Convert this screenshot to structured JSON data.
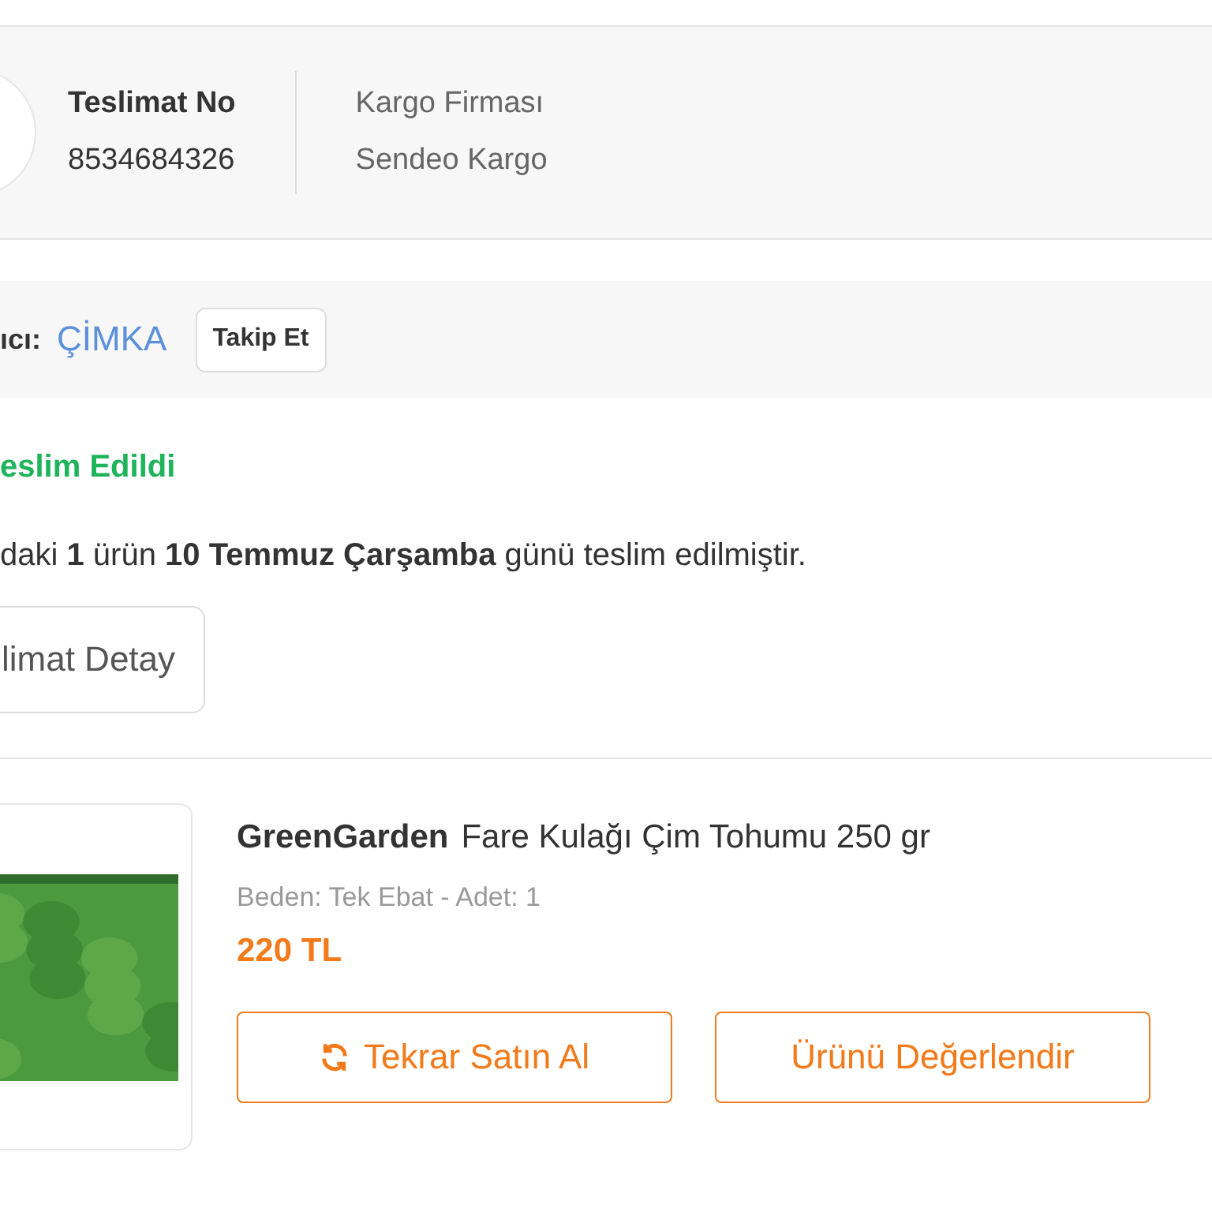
{
  "delivery": {
    "number_label": "Teslimat No",
    "number": "8534684326",
    "carrier_label": "Kargo Firması",
    "carrier": "Sendeo Kargo"
  },
  "seller": {
    "label": "ıcı:",
    "name": "ÇİMKA",
    "follow_button": "Takip Et"
  },
  "status": {
    "text": "eslim Edildi",
    "message": "daki **1** ürün **10 Temmuz Çarşamba** günü teslim edilmiştir.",
    "detail_button": "limat Detay"
  },
  "product": {
    "brand": "GreenGarden",
    "name": "Fare Kulağı Çim Tohumu 250 gr",
    "variant": "Beden: Tek Ebat - Adet: 1",
    "price": "220 TL",
    "buttons": [
      {
        "kind": "rebuy",
        "label": "Tekrar Satın Al"
      },
      {
        "kind": "review",
        "label": "Ürünü Değerlendir"
      }
    ]
  }
}
